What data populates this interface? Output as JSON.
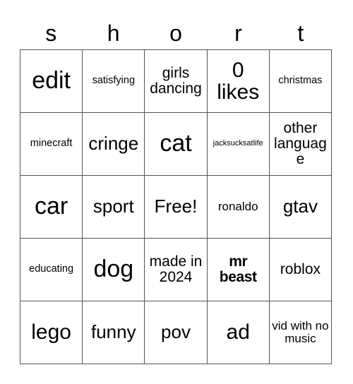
{
  "card": {
    "header_letters": [
      "s",
      "h",
      "o",
      "r",
      "t"
    ],
    "columns": 5,
    "rows": 5,
    "free_space_label": "Free!",
    "border_color": "#555555",
    "text_color": "#000000",
    "background_color": "#ffffff",
    "cells": [
      [
        {
          "text": "edit",
          "size": "fs-xxl",
          "bold": false
        },
        {
          "text": "satisfying",
          "size": "fs-xs",
          "bold": false
        },
        {
          "text": "girls dancing",
          "size": "fs-m",
          "bold": false
        },
        {
          "text": "0 likes",
          "size": "fs-xl",
          "bold": false
        },
        {
          "text": "christmas",
          "size": "fs-xs",
          "bold": false
        }
      ],
      [
        {
          "text": "minecraft",
          "size": "fs-xs",
          "bold": false
        },
        {
          "text": "cringe",
          "size": "fs-l",
          "bold": false
        },
        {
          "text": "cat",
          "size": "fs-xxl",
          "bold": false
        },
        {
          "text": "jacksucksatlife",
          "size": "fs-xxs",
          "bold": false
        },
        {
          "text": "other language",
          "size": "fs-m",
          "bold": false
        }
      ],
      [
        {
          "text": "car",
          "size": "fs-xxl",
          "bold": false
        },
        {
          "text": "sport",
          "size": "fs-l",
          "bold": false
        },
        {
          "text": "Free!",
          "size": "fs-l",
          "bold": false
        },
        {
          "text": "ronaldo",
          "size": "fs-s",
          "bold": false
        },
        {
          "text": "gtav",
          "size": "fs-l",
          "bold": false
        }
      ],
      [
        {
          "text": "educating",
          "size": "fs-xs",
          "bold": false
        },
        {
          "text": "dog",
          "size": "fs-xxl",
          "bold": false
        },
        {
          "text": "made in 2024",
          "size": "fs-m",
          "bold": false
        },
        {
          "text": "mr beast",
          "size": "fs-m",
          "bold": true
        },
        {
          "text": "roblox",
          "size": "fs-m",
          "bold": false
        }
      ],
      [
        {
          "text": "lego",
          "size": "fs-xl",
          "bold": false
        },
        {
          "text": "funny",
          "size": "fs-l",
          "bold": false
        },
        {
          "text": "pov",
          "size": "fs-l",
          "bold": false
        },
        {
          "text": "ad",
          "size": "fs-xl",
          "bold": false
        },
        {
          "text": "vid with no music",
          "size": "fs-s",
          "bold": false
        }
      ]
    ]
  }
}
